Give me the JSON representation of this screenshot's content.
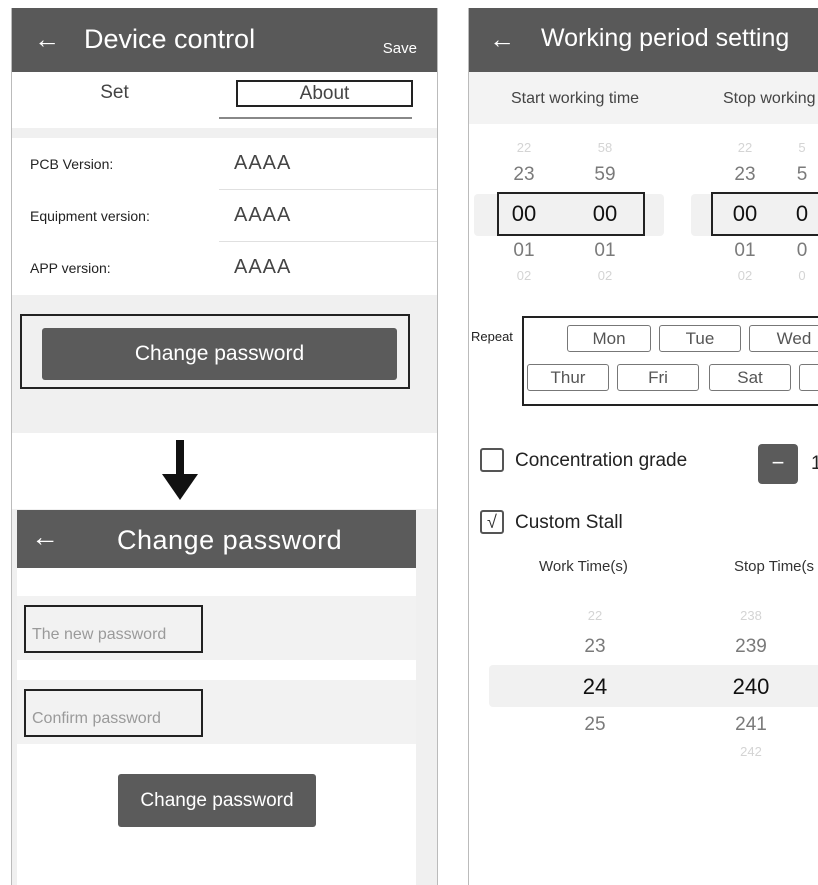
{
  "device_control": {
    "back_icon": "back-arrow-icon",
    "title": "Device control",
    "save_label": "Save",
    "tabs": {
      "set": "Set",
      "about": "About"
    },
    "info": [
      {
        "label": "PCB Version:",
        "value": "AAAA"
      },
      {
        "label": "Equipment version:",
        "value": "AAAA"
      },
      {
        "label": "APP version:",
        "value": "AAAA"
      }
    ],
    "change_password_label": "Change password"
  },
  "change_password": {
    "title": "Change password",
    "new_password_placeholder": "The new password",
    "confirm_password_placeholder": "Confirm password",
    "submit_label": "Change password"
  },
  "working_period": {
    "title": "Working period setting",
    "start_label": "Start working time",
    "stop_label": "Stop working",
    "start_hours": [
      "22",
      "23",
      "00",
      "01",
      "02"
    ],
    "start_minutes": [
      "58",
      "59",
      "00",
      "01",
      "02"
    ],
    "stop_hours": [
      "22",
      "23",
      "00",
      "01",
      "02"
    ],
    "stop_minutes": [
      "5",
      "5",
      "0",
      "0",
      "0"
    ],
    "repeat_label": "Repeat",
    "days": [
      "Mon",
      "Tue",
      "Wed",
      "Thur",
      "Fri",
      "Sat",
      ""
    ],
    "concentration_label": "Concentration grade",
    "concentration_checked": false,
    "minus_label": "−",
    "concentration_value": "1",
    "custom_stall_label": "Custom  Stall",
    "custom_stall_checked": "√",
    "work_time_label": "Work Time(s)",
    "stop_time_label": "Stop Time(s",
    "work_times": [
      "22",
      "23",
      "24",
      "25"
    ],
    "stop_times": [
      "238",
      "239",
      "240",
      "241",
      "242"
    ]
  },
  "colors": {
    "header": "#595959",
    "button": "#5b5b5b",
    "background": "#f0f0f0"
  }
}
